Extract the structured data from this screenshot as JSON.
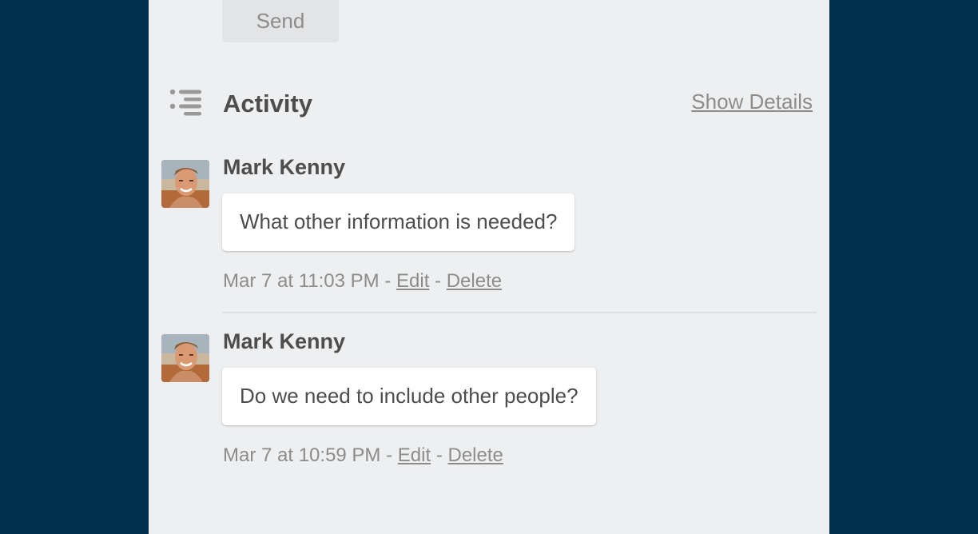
{
  "composer": {
    "send_label": "Send"
  },
  "activity": {
    "title": "Activity",
    "show_details_label": "Show Details",
    "icon": "activity-list-icon"
  },
  "comments": [
    {
      "author": "Mark Kenny",
      "text": "What other information is needed?",
      "timestamp": "Mar 7 at 11:03 PM",
      "edit_label": "Edit",
      "delete_label": "Delete"
    },
    {
      "author": "Mark Kenny",
      "text": "Do we need to include other people?",
      "timestamp": "Mar 7 at 10:59 PM",
      "edit_label": "Edit",
      "delete_label": "Delete"
    }
  ],
  "colors": {
    "background": "#01304f",
    "panel": "#edeff0",
    "text": "#4d4d4d",
    "muted": "#8c8c8c"
  }
}
